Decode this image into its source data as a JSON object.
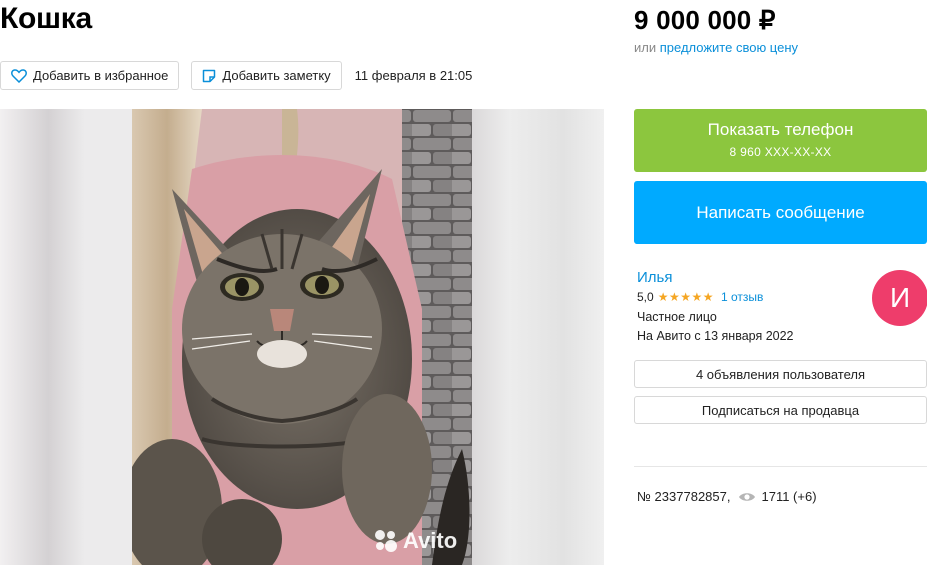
{
  "listing": {
    "title": "Кошка",
    "price": "9 000 000 ₽",
    "offer_prefix": "или",
    "offer_link": "предложите свою цену",
    "favorite_label": "Добавить в избранное",
    "note_label": "Добавить заметку",
    "date": "11 февраля в 21:05",
    "watermark": "Avito",
    "id_text": "№ 2337782857,",
    "views": "1711 (+6)"
  },
  "contact": {
    "phone_button": "Показать телефон",
    "phone_number": "8 960 XXX-XX-XX",
    "message_button": "Написать сообщение"
  },
  "seller": {
    "name": "Илья",
    "rating": "5,0",
    "stars": "★★★★★",
    "reviews": "1 отзыв",
    "type": "Частное лицо",
    "since": "На Авито с 13 января 2022",
    "avatar_letter": "И",
    "listings_button": "4 объявления пользователя",
    "subscribe_button": "Подписаться на продавца"
  },
  "colors": {
    "phone_button": "#8cc63e",
    "message_button": "#00aaff",
    "link": "#0a8fd9",
    "avatar": "#ee3d6b",
    "stars": "#f5a623"
  },
  "icons": [
    "heart-icon",
    "note-icon",
    "eye-icon",
    "avito-logo-icon"
  ]
}
